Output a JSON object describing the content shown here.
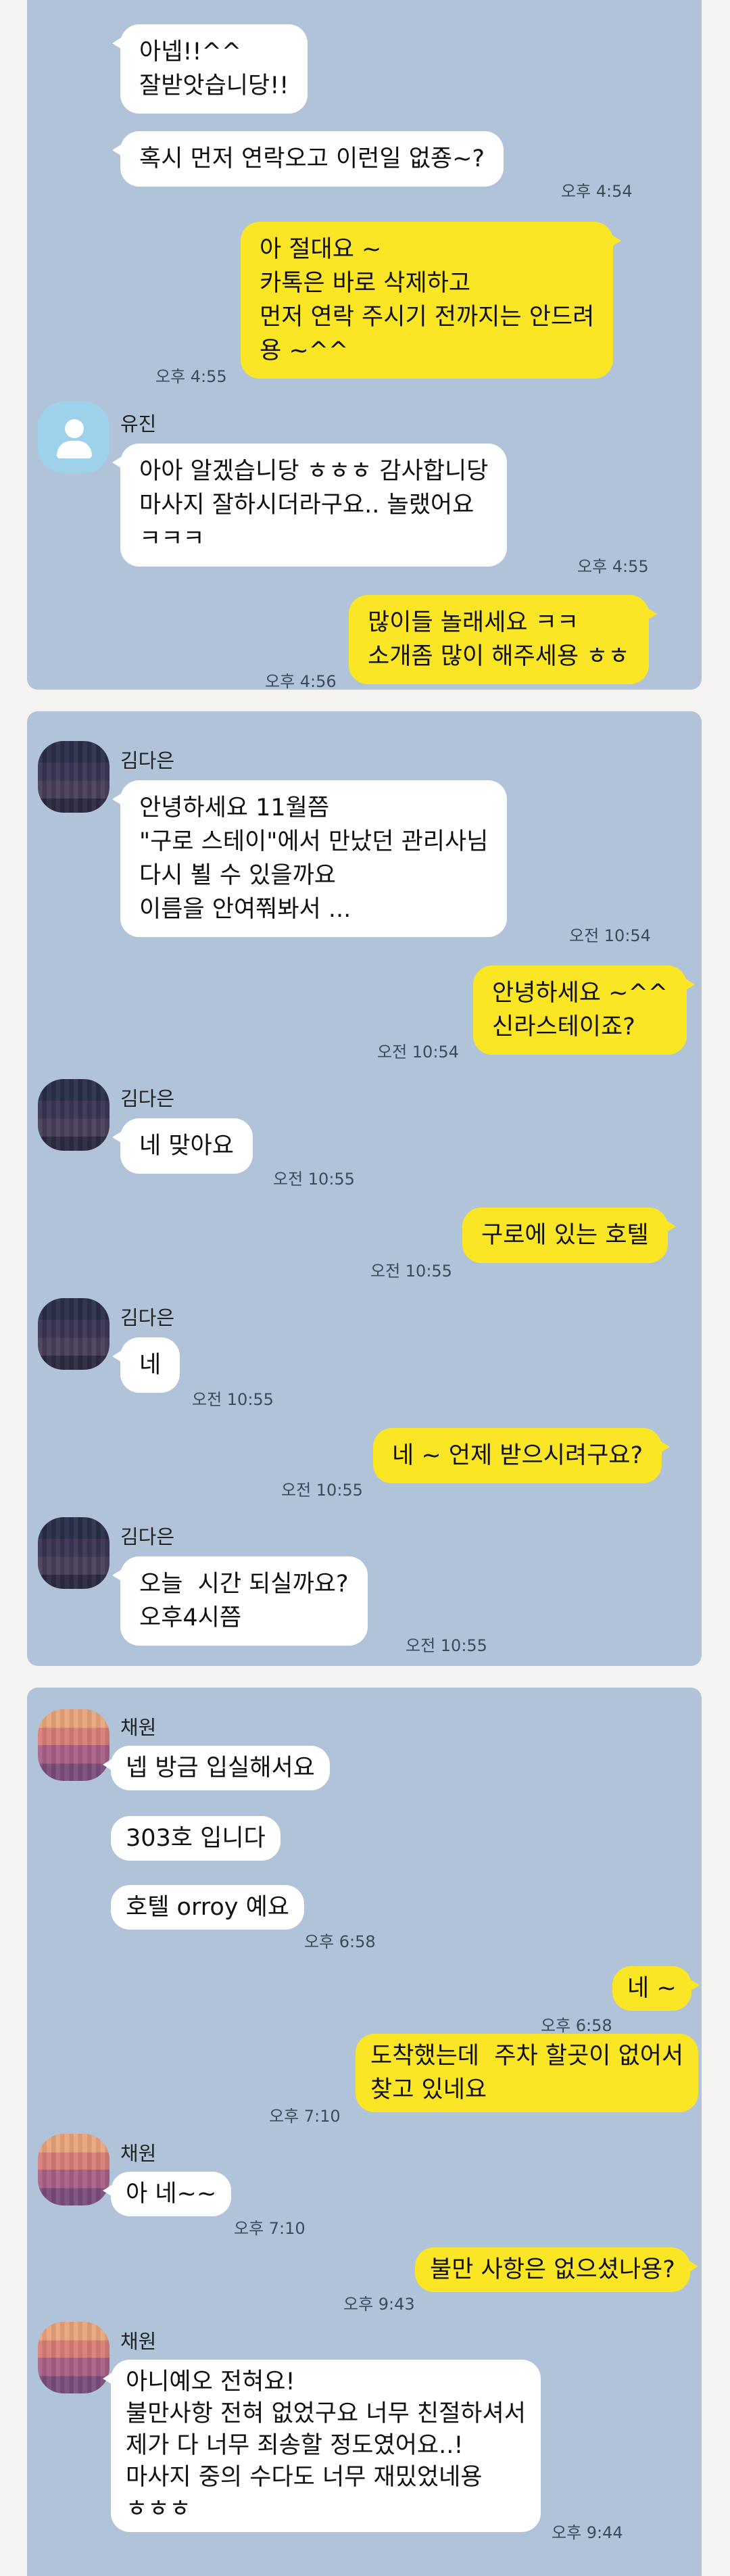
{
  "panels": [
    {
      "id": "chat1",
      "messages": [
        {
          "dir": "in",
          "text": "아넵!!^^\n잘받앗습니당!!"
        },
        {
          "dir": "in",
          "text": "혹시 먼저 연락오고 이런일 없죵~?",
          "time": "오후 4:54"
        },
        {
          "dir": "out",
          "text": "아 절대요 ~\n카톡은 바로 삭제하고\n먼저 연락 주시기 전까지는 안드려\n용 ~^^",
          "time": "오후 4:55"
        },
        {
          "sender": "유진",
          "dir": "in",
          "text": "아아 알겠습니당 ㅎㅎㅎ 감사합니당\n마사지 잘하시더라구요.. 놀랬어요\nㅋㅋㅋ",
          "time": "오후 4:55"
        },
        {
          "dir": "out",
          "text": "많이들 놀래세요 ㅋㅋ\n소개좀 많이 해주세용 ㅎㅎ",
          "time": "오후 4:56"
        }
      ]
    },
    {
      "id": "chat2",
      "messages": [
        {
          "sender": "김다은",
          "dir": "in",
          "text": "안녕하세요 11월쯤\n\"구로 스테이\"에서 만났던 관리사님\n다시 뵐 수 있을까요\n이름을 안여쭤봐서 ...",
          "time": "오전 10:54"
        },
        {
          "dir": "out",
          "text": "안녕하세요 ~^^\n신라스테이죠?",
          "time": "오전 10:54"
        },
        {
          "sender": "김다은",
          "dir": "in",
          "text": "네 맞아요",
          "time": "오전 10:55"
        },
        {
          "dir": "out",
          "text": "구로에 있는 호텔",
          "time": "오전 10:55"
        },
        {
          "sender": "김다은",
          "dir": "in",
          "text": "네",
          "time": "오전 10:55"
        },
        {
          "dir": "out",
          "text": "네 ~ 언제 받으시려구요?",
          "time": "오전 10:55"
        },
        {
          "sender": "김다은",
          "dir": "in",
          "text": "오늘  시간 되실까요?\n오후4시쯤",
          "time": "오전 10:55"
        }
      ]
    },
    {
      "id": "chat3",
      "messages": [
        {
          "sender": "채원",
          "dir": "in",
          "text": "넵 방금 입실해서요"
        },
        {
          "dir": "in",
          "text": "303호 입니다"
        },
        {
          "dir": "in",
          "text": "호텔 orroy 예요",
          "time": "오후 6:58"
        },
        {
          "dir": "out",
          "text": "네 ~",
          "time": "오후 6:58"
        },
        {
          "dir": "out",
          "text": "도착했는데  주차 할곳이 없어서\n찾고 있네요",
          "time": "오후 7:10"
        },
        {
          "sender": "채원",
          "dir": "in",
          "text": "아 네~~",
          "time": "오후 7:10"
        },
        {
          "dir": "out",
          "text": "불만 사항은 없으셨나용?",
          "time": "오후 9:43"
        },
        {
          "sender": "채원",
          "dir": "in",
          "text": "아니예오 전혀요!\n불만사항 전혀 없었구요 너무 친절하셔서\n제가 다 너무 죄송할 정도였어요..!\n마사지 중의 수다도 너무 재밌었네용\nㅎㅎㅎ",
          "time": "오후 9:44"
        }
      ]
    }
  ],
  "colors": {
    "incoming": "#ffffff",
    "outgoing": "#fbe626",
    "panel": "#b0c3d8",
    "page": "#f5f3f1"
  }
}
